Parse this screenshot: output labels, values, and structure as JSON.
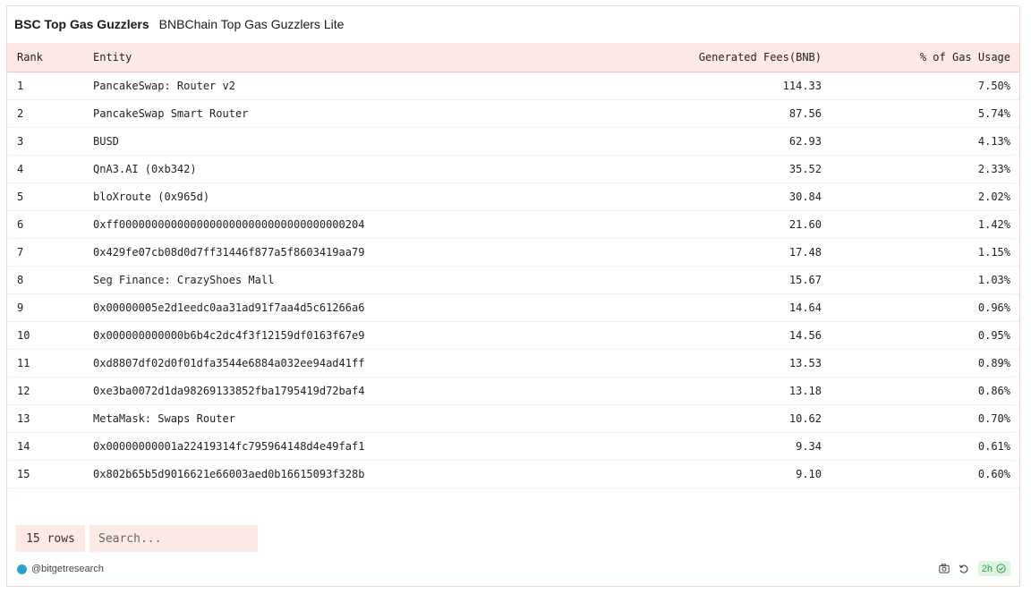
{
  "header": {
    "title": "BSC Top Gas Guzzlers",
    "subtitle": "BNBChain Top Gas Guzzlers Lite"
  },
  "table": {
    "columns": [
      "Rank",
      "Entity",
      "Generated Fees(BNB)",
      "% of Gas Usage"
    ],
    "rows": [
      [
        "1",
        "PancakeSwap: Router v2",
        "114.33",
        "7.50%"
      ],
      [
        "2",
        "PancakeSwap Smart Router",
        "87.56",
        "5.74%"
      ],
      [
        "3",
        "BUSD",
        "62.93",
        "4.13%"
      ],
      [
        "4",
        "QnA3.AI (0xb342)",
        "35.52",
        "2.33%"
      ],
      [
        "5",
        "bloXroute (0x965d)",
        "30.84",
        "2.02%"
      ],
      [
        "6",
        "0xff00000000000000000000000000000000000204",
        "21.60",
        "1.42%"
      ],
      [
        "7",
        "0x429fe07cb08d0d7ff31446f877a5f8603419aa79",
        "17.48",
        "1.15%"
      ],
      [
        "8",
        "Seg Finance: CrazyShoes Mall",
        "15.67",
        "1.03%"
      ],
      [
        "9",
        "0x00000005e2d1eedc0aa31ad91f7aa4d5c61266a6",
        "14.64",
        "0.96%"
      ],
      [
        "10",
        "0x000000000000b6b4c2dc4f3f12159df0163f67e9",
        "14.56",
        "0.95%"
      ],
      [
        "11",
        "0xd8807df02d0f01dfa3544e6884a032ee94ad41ff",
        "13.53",
        "0.89%"
      ],
      [
        "12",
        "0xe3ba0072d1da98269133852fba1795419d72baf4",
        "13.18",
        "0.86%"
      ],
      [
        "13",
        "MetaMask: Swaps Router",
        "10.62",
        "0.70%"
      ],
      [
        "14",
        "0x00000000001a22419314fc795964148d4e49faf1",
        "9.34",
        "0.61%"
      ],
      [
        "15",
        "0x802b65b5d9016621e66003aed0b16615093f328b",
        "9.10",
        "0.60%"
      ]
    ]
  },
  "footer": {
    "row_count": "15 rows",
    "search_placeholder": "Search...",
    "author": "@bitgetresearch",
    "age": "2h",
    "icons": [
      "camera-icon",
      "refresh-icon",
      "check-circle-icon"
    ]
  },
  "colors": {
    "accent_bg": "#fdeae6",
    "border": "#f6d5cd",
    "fresh_green": "#2e9b4a"
  }
}
